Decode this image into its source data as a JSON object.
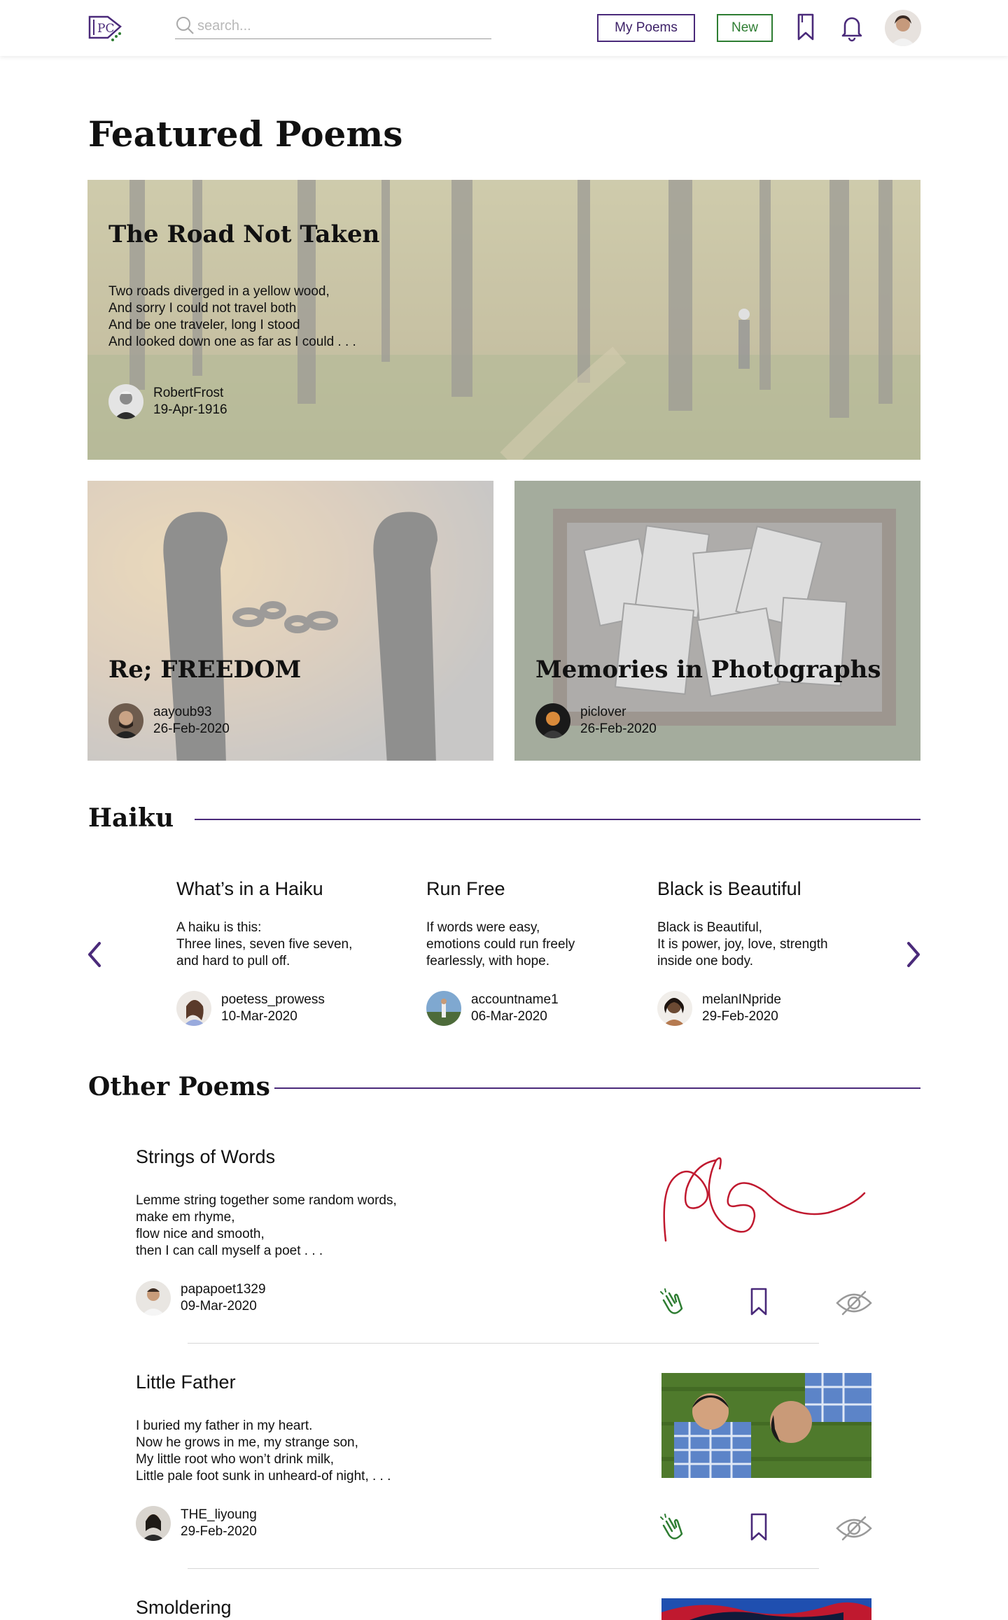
{
  "header": {
    "search_placeholder": "search...",
    "my_poems_label": "My Poems",
    "new_label": "New"
  },
  "featured": {
    "heading": "Featured Poems",
    "main": {
      "title": "The Road Not Taken",
      "excerpt": "Two roads diverged in a yellow wood,\nAnd sorry I could not travel both\nAnd be one traveler, long I stood\nAnd looked down one as far as I could . . .",
      "author": "RobertFrost",
      "date": "19-Apr-1916"
    },
    "left": {
      "title": "Re; FREEDOM",
      "author": "aayoub93",
      "date": "26-Feb-2020"
    },
    "right": {
      "title": "Memories in Photographs",
      "author": "piclover",
      "date": "26-Feb-2020"
    }
  },
  "haiku": {
    "heading": "Haiku",
    "items": [
      {
        "title": "What’s in a Haiku",
        "text": "A haiku is this:\nThree lines, seven five seven,\nand hard to pull off.",
        "author": "poetess_prowess",
        "date": "10-Mar-2020"
      },
      {
        "title": "Run Free",
        "text": "If words were easy,\nemotions could run freely\nfearlessly, with hope.",
        "author": "accountname1",
        "date": "06-Mar-2020"
      },
      {
        "title": "Black is Beautiful",
        "text": "Black is Beautiful,\nIt is power, joy, love, strength\ninside one body.",
        "author": "melanINpride",
        "date": "29-Feb-2020"
      }
    ]
  },
  "other": {
    "heading": "Other Poems",
    "items": [
      {
        "title": "Strings of Words",
        "text": "Lemme string together some random words,\nmake em rhyme,\nflow nice and smooth,\nthen I can call myself a poet . . .",
        "author": "papapoet1329",
        "date": "09-Mar-2020"
      },
      {
        "title": "Little Father",
        "text": "I buried my father in my heart.\nNow he grows in me, my strange son,\nMy little root who won’t drink milk,\nLittle pale foot sunk in unheard-of night, . . .",
        "author": "THE_liyoung",
        "date": "29-Feb-2020"
      },
      {
        "title": "Smoldering",
        "text": "",
        "author": "",
        "date": ""
      }
    ]
  },
  "colors": {
    "brand_purple": "#4a2a7a",
    "new_green": "#2e7d32",
    "string_red": "#c0192f"
  },
  "icons": [
    "logo-icon",
    "search-icon",
    "bookmark-icon",
    "bell-icon",
    "chevron-left-icon",
    "chevron-right-icon",
    "clap-icon",
    "eye-off-icon"
  ]
}
